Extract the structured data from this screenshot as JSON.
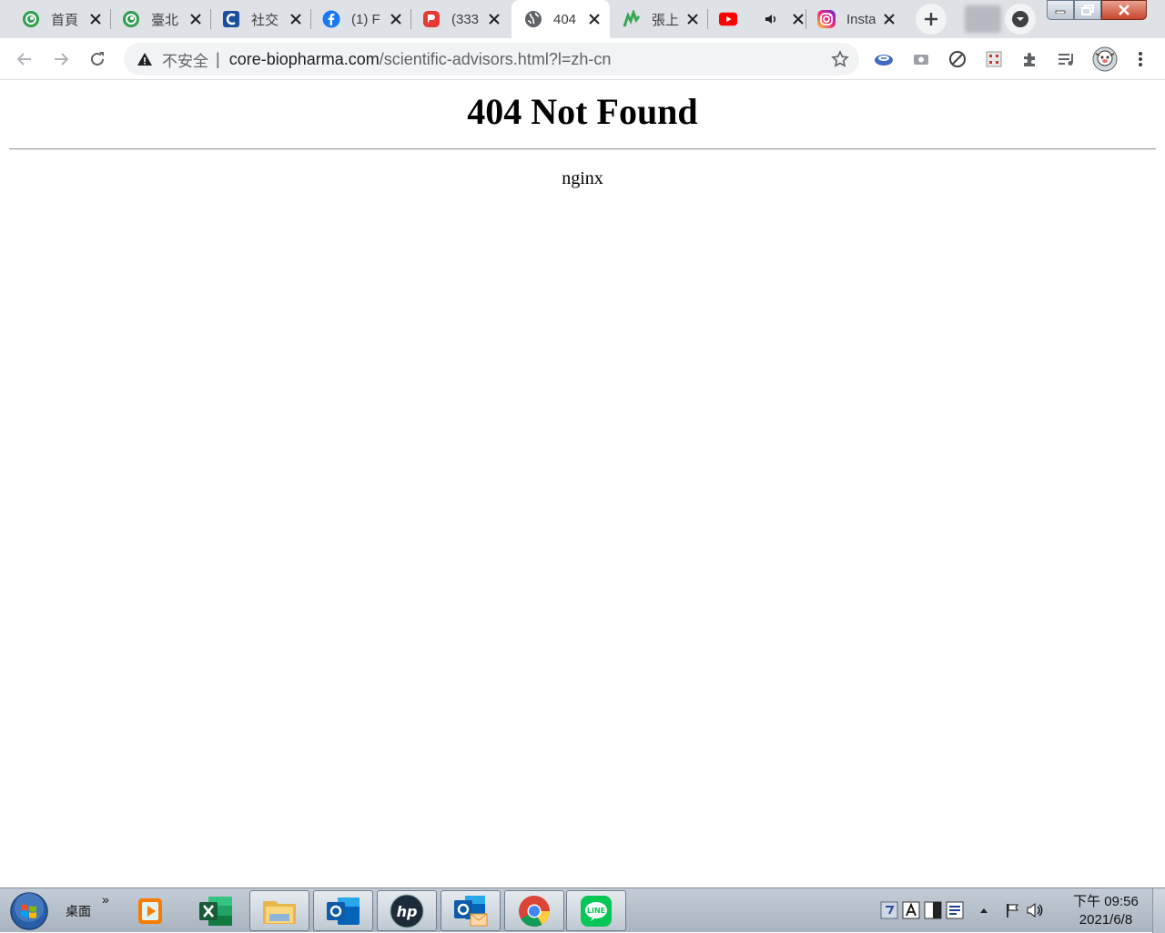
{
  "tabs": [
    {
      "title": "首頁",
      "icon": "spiral-green-icon",
      "color": "#2e9e4f"
    },
    {
      "title": "臺北",
      "icon": "spiral-green-icon",
      "color": "#2e9e4f"
    },
    {
      "title": "社交",
      "icon": "c-blue-icon",
      "color": "#1a4f9c"
    },
    {
      "title": "(1) F",
      "icon": "facebook-icon",
      "color": "#1877f2"
    },
    {
      "title": "(333",
      "icon": "red-badge-icon",
      "color": "#e53935"
    },
    {
      "title": "404",
      "icon": "globe-icon",
      "color": "#5f6368",
      "active": true
    },
    {
      "title": "張上",
      "icon": "green-chart-icon",
      "color": "#34a853"
    },
    {
      "title": "",
      "icon": "youtube-icon",
      "color": "#ff0000",
      "audio": true
    },
    {
      "title": "Insta",
      "icon": "instagram-icon",
      "color": "#c13584"
    }
  ],
  "omnibox": {
    "security_label": "不安全",
    "host": "core-biopharma.com",
    "path": "/scientific-advisors.html?l=zh-cn"
  },
  "page": {
    "heading": "404 Not Found",
    "server": "nginx"
  },
  "taskbar": {
    "desktop_label": "桌面",
    "chevron": "»",
    "clock_time": "下午 09:56",
    "clock_date": "2021/6/8"
  }
}
